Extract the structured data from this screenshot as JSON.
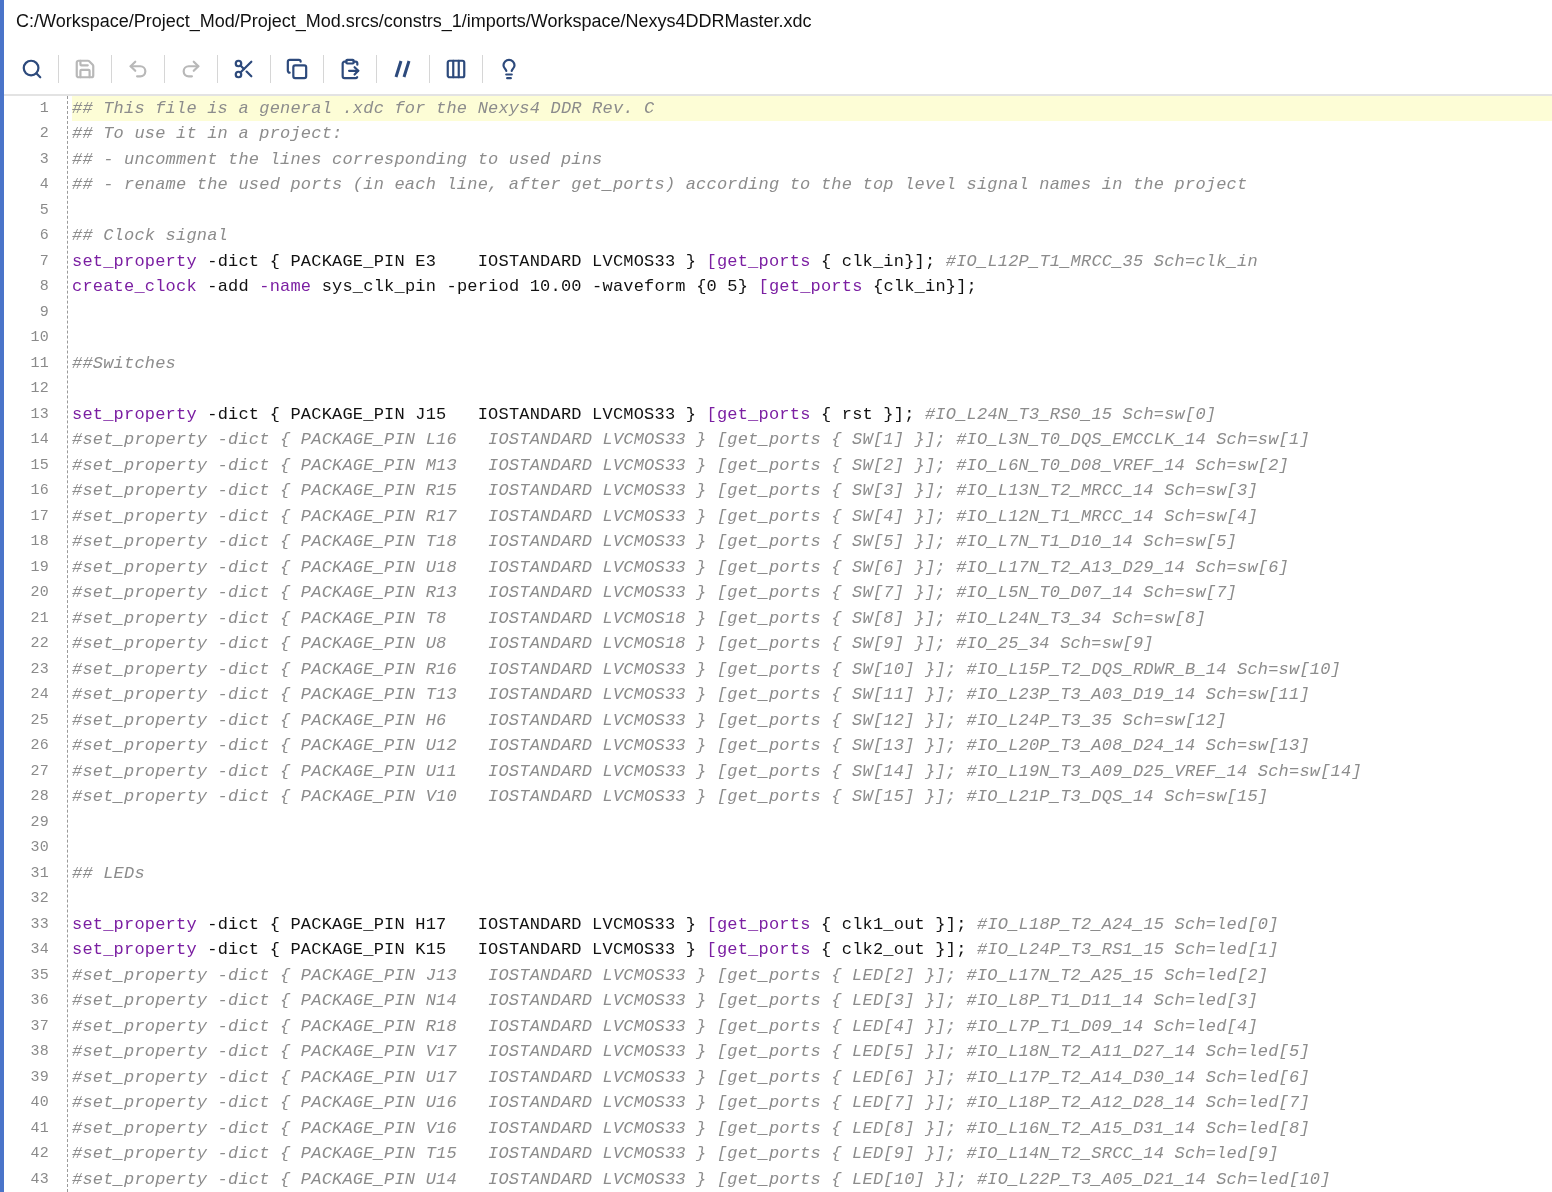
{
  "window": {
    "title": "C:/Workspace/Project_Mod/Project_Mod.srcs/constrs_1/imports/Workspace/Nexys4DDRMaster.xdc"
  },
  "toolbar": [
    {
      "kind": "search",
      "disabled": false
    },
    {
      "kind": "save",
      "disabled": true
    },
    {
      "kind": "undo",
      "disabled": true
    },
    {
      "kind": "redo",
      "disabled": true
    },
    {
      "kind": "cut",
      "disabled": false
    },
    {
      "kind": "copy",
      "disabled": false
    },
    {
      "kind": "paste",
      "disabled": false
    },
    {
      "kind": "comment",
      "disabled": false
    },
    {
      "kind": "columns",
      "disabled": false
    },
    {
      "kind": "hint",
      "disabled": false
    }
  ],
  "editor": {
    "lines": [
      {
        "number": "1",
        "current": true,
        "tokens": [
          {
            "kind": "comment",
            "text": "## This file is a general .xdc for the Nexys4 DDR Rev. C"
          }
        ]
      },
      {
        "number": "2",
        "current": false,
        "tokens": [
          {
            "kind": "comment",
            "text": "## To use it in a project:"
          }
        ]
      },
      {
        "number": "3",
        "current": false,
        "tokens": [
          {
            "kind": "comment",
            "text": "## - uncomment the lines corresponding to used pins"
          }
        ]
      },
      {
        "number": "4",
        "current": false,
        "tokens": [
          {
            "kind": "comment",
            "text": "## - rename the used ports (in each line, after get_ports) according to the top level signal names in the project"
          }
        ]
      },
      {
        "number": "5",
        "current": false
      },
      {
        "number": "6",
        "current": false,
        "tokens": [
          {
            "kind": "comment",
            "text": "## Clock signal"
          }
        ]
      },
      {
        "number": "7",
        "current": false,
        "tokens": [
          {
            "kind": "keyword",
            "text": "set_property"
          },
          {
            "kind": "plain",
            "text": " -dict { PACKAGE_PIN E3    IOSTANDARD LVCMOS33 } "
          },
          {
            "kind": "keyword",
            "text": "[get_ports"
          },
          {
            "kind": "plain",
            "text": " { clk_in}]; "
          },
          {
            "kind": "comment",
            "text": "#IO_L12P_T1_MRCC_35 Sch=clk_in"
          }
        ]
      },
      {
        "number": "8",
        "current": false,
        "tokens": [
          {
            "kind": "keyword",
            "text": "create_clock"
          },
          {
            "kind": "plain",
            "text": " -add "
          },
          {
            "kind": "keyword",
            "text": "-name"
          },
          {
            "kind": "plain",
            "text": " sys_clk_pin -period 10.00 -waveform {0 5} "
          },
          {
            "kind": "keyword",
            "text": "[get_ports"
          },
          {
            "kind": "plain",
            "text": " {clk_in}];"
          }
        ]
      },
      {
        "number": "9",
        "current": false
      },
      {
        "number": "10",
        "current": false
      },
      {
        "number": "11",
        "current": false,
        "tokens": [
          {
            "kind": "comment",
            "text": "##Switches"
          }
        ]
      },
      {
        "number": "12",
        "current": false
      },
      {
        "number": "13",
        "current": false,
        "tokens": [
          {
            "kind": "keyword",
            "text": "set_property"
          },
          {
            "kind": "plain",
            "text": " -dict { PACKAGE_PIN J15   IOSTANDARD LVCMOS33 } "
          },
          {
            "kind": "keyword",
            "text": "[get_ports"
          },
          {
            "kind": "plain",
            "text": " { rst }]; "
          },
          {
            "kind": "comment",
            "text": "#IO_L24N_T3_RS0_15 Sch=sw[0]"
          }
        ]
      },
      {
        "number": "14",
        "current": false,
        "tokens": [
          {
            "kind": "comment",
            "text": "#set_property -dict { PACKAGE_PIN L16   IOSTANDARD LVCMOS33 } [get_ports { SW[1] }]; #IO_L3N_T0_DQS_EMCCLK_14 Sch=sw[1]"
          }
        ]
      },
      {
        "number": "15",
        "current": false,
        "tokens": [
          {
            "kind": "comment",
            "text": "#set_property -dict { PACKAGE_PIN M13   IOSTANDARD LVCMOS33 } [get_ports { SW[2] }]; #IO_L6N_T0_D08_VREF_14 Sch=sw[2]"
          }
        ]
      },
      {
        "number": "16",
        "current": false,
        "tokens": [
          {
            "kind": "comment",
            "text": "#set_property -dict { PACKAGE_PIN R15   IOSTANDARD LVCMOS33 } [get_ports { SW[3] }]; #IO_L13N_T2_MRCC_14 Sch=sw[3]"
          }
        ]
      },
      {
        "number": "17",
        "current": false,
        "tokens": [
          {
            "kind": "comment",
            "text": "#set_property -dict { PACKAGE_PIN R17   IOSTANDARD LVCMOS33 } [get_ports { SW[4] }]; #IO_L12N_T1_MRCC_14 Sch=sw[4]"
          }
        ]
      },
      {
        "number": "18",
        "current": false,
        "tokens": [
          {
            "kind": "comment",
            "text": "#set_property -dict { PACKAGE_PIN T18   IOSTANDARD LVCMOS33 } [get_ports { SW[5] }]; #IO_L7N_T1_D10_14 Sch=sw[5]"
          }
        ]
      },
      {
        "number": "19",
        "current": false,
        "tokens": [
          {
            "kind": "comment",
            "text": "#set_property -dict { PACKAGE_PIN U18   IOSTANDARD LVCMOS33 } [get_ports { SW[6] }]; #IO_L17N_T2_A13_D29_14 Sch=sw[6]"
          }
        ]
      },
      {
        "number": "20",
        "current": false,
        "tokens": [
          {
            "kind": "comment",
            "text": "#set_property -dict { PACKAGE_PIN R13   IOSTANDARD LVCMOS33 } [get_ports { SW[7] }]; #IO_L5N_T0_D07_14 Sch=sw[7]"
          }
        ]
      },
      {
        "number": "21",
        "current": false,
        "tokens": [
          {
            "kind": "comment",
            "text": "#set_property -dict { PACKAGE_PIN T8    IOSTANDARD LVCMOS18 } [get_ports { SW[8] }]; #IO_L24N_T3_34 Sch=sw[8]"
          }
        ]
      },
      {
        "number": "22",
        "current": false,
        "tokens": [
          {
            "kind": "comment",
            "text": "#set_property -dict { PACKAGE_PIN U8    IOSTANDARD LVCMOS18 } [get_ports { SW[9] }]; #IO_25_34 Sch=sw[9]"
          }
        ]
      },
      {
        "number": "23",
        "current": false,
        "tokens": [
          {
            "kind": "comment",
            "text": "#set_property -dict { PACKAGE_PIN R16   IOSTANDARD LVCMOS33 } [get_ports { SW[10] }]; #IO_L15P_T2_DQS_RDWR_B_14 Sch=sw[10]"
          }
        ]
      },
      {
        "number": "24",
        "current": false,
        "tokens": [
          {
            "kind": "comment",
            "text": "#set_property -dict { PACKAGE_PIN T13   IOSTANDARD LVCMOS33 } [get_ports { SW[11] }]; #IO_L23P_T3_A03_D19_14 Sch=sw[11]"
          }
        ]
      },
      {
        "number": "25",
        "current": false,
        "tokens": [
          {
            "kind": "comment",
            "text": "#set_property -dict { PACKAGE_PIN H6    IOSTANDARD LVCMOS33 } [get_ports { SW[12] }]; #IO_L24P_T3_35 Sch=sw[12]"
          }
        ]
      },
      {
        "number": "26",
        "current": false,
        "tokens": [
          {
            "kind": "comment",
            "text": "#set_property -dict { PACKAGE_PIN U12   IOSTANDARD LVCMOS33 } [get_ports { SW[13] }]; #IO_L20P_T3_A08_D24_14 Sch=sw[13]"
          }
        ]
      },
      {
        "number": "27",
        "current": false,
        "tokens": [
          {
            "kind": "comment",
            "text": "#set_property -dict { PACKAGE_PIN U11   IOSTANDARD LVCMOS33 } [get_ports { SW[14] }]; #IO_L19N_T3_A09_D25_VREF_14 Sch=sw[14]"
          }
        ]
      },
      {
        "number": "28",
        "current": false,
        "tokens": [
          {
            "kind": "comment",
            "text": "#set_property -dict { PACKAGE_PIN V10   IOSTANDARD LVCMOS33 } [get_ports { SW[15] }]; #IO_L21P_T3_DQS_14 Sch=sw[15]"
          }
        ]
      },
      {
        "number": "29",
        "current": false
      },
      {
        "number": "30",
        "current": false
      },
      {
        "number": "31",
        "current": false,
        "tokens": [
          {
            "kind": "comment",
            "text": "## LEDs"
          }
        ]
      },
      {
        "number": "32",
        "current": false
      },
      {
        "number": "33",
        "current": false,
        "tokens": [
          {
            "kind": "keyword",
            "text": "set_property"
          },
          {
            "kind": "plain",
            "text": " -dict { PACKAGE_PIN H17   IOSTANDARD LVCMOS33 } "
          },
          {
            "kind": "keyword",
            "text": "[get_ports"
          },
          {
            "kind": "plain",
            "text": " { clk1_out }]; "
          },
          {
            "kind": "comment",
            "text": "#IO_L18P_T2_A24_15 Sch=led[0]"
          }
        ]
      },
      {
        "number": "34",
        "current": false,
        "tokens": [
          {
            "kind": "keyword",
            "text": "set_property"
          },
          {
            "kind": "plain",
            "text": " -dict { PACKAGE_PIN K15   IOSTANDARD LVCMOS33 } "
          },
          {
            "kind": "keyword",
            "text": "[get_ports"
          },
          {
            "kind": "plain",
            "text": " { clk2_out }]; "
          },
          {
            "kind": "comment",
            "text": "#IO_L24P_T3_RS1_15 Sch=led[1]"
          }
        ]
      },
      {
        "number": "35",
        "current": false,
        "tokens": [
          {
            "kind": "comment",
            "text": "#set_property -dict { PACKAGE_PIN J13   IOSTANDARD LVCMOS33 } [get_ports { LED[2] }]; #IO_L17N_T2_A25_15 Sch=led[2]"
          }
        ]
      },
      {
        "number": "36",
        "current": false,
        "tokens": [
          {
            "kind": "comment",
            "text": "#set_property -dict { PACKAGE_PIN N14   IOSTANDARD LVCMOS33 } [get_ports { LED[3] }]; #IO_L8P_T1_D11_14 Sch=led[3]"
          }
        ]
      },
      {
        "number": "37",
        "current": false,
        "tokens": [
          {
            "kind": "comment",
            "text": "#set_property -dict { PACKAGE_PIN R18   IOSTANDARD LVCMOS33 } [get_ports { LED[4] }]; #IO_L7P_T1_D09_14 Sch=led[4]"
          }
        ]
      },
      {
        "number": "38",
        "current": false,
        "tokens": [
          {
            "kind": "comment",
            "text": "#set_property -dict { PACKAGE_PIN V17   IOSTANDARD LVCMOS33 } [get_ports { LED[5] }]; #IO_L18N_T2_A11_D27_14 Sch=led[5]"
          }
        ]
      },
      {
        "number": "39",
        "current": false,
        "tokens": [
          {
            "kind": "comment",
            "text": "#set_property -dict { PACKAGE_PIN U17   IOSTANDARD LVCMOS33 } [get_ports { LED[6] }]; #IO_L17P_T2_A14_D30_14 Sch=led[6]"
          }
        ]
      },
      {
        "number": "40",
        "current": false,
        "tokens": [
          {
            "kind": "comment",
            "text": "#set_property -dict { PACKAGE_PIN U16   IOSTANDARD LVCMOS33 } [get_ports { LED[7] }]; #IO_L18P_T2_A12_D28_14 Sch=led[7]"
          }
        ]
      },
      {
        "number": "41",
        "current": false,
        "tokens": [
          {
            "kind": "comment",
            "text": "#set_property -dict { PACKAGE_PIN V16   IOSTANDARD LVCMOS33 } [get_ports { LED[8] }]; #IO_L16N_T2_A15_D31_14 Sch=led[8]"
          }
        ]
      },
      {
        "number": "42",
        "current": false,
        "tokens": [
          {
            "kind": "comment",
            "text": "#set_property -dict { PACKAGE_PIN T15   IOSTANDARD LVCMOS33 } [get_ports { LED[9] }]; #IO_L14N_T2_SRCC_14 Sch=led[9]"
          }
        ]
      },
      {
        "number": "43",
        "current": false,
        "tokens": [
          {
            "kind": "comment",
            "text": "#set_property -dict { PACKAGE_PIN U14   IOSTANDARD LVCMOS33 } [get_ports { LED[10] }]; #IO_L22P_T3_A05_D21_14 Sch=led[10]"
          }
        ]
      }
    ]
  }
}
